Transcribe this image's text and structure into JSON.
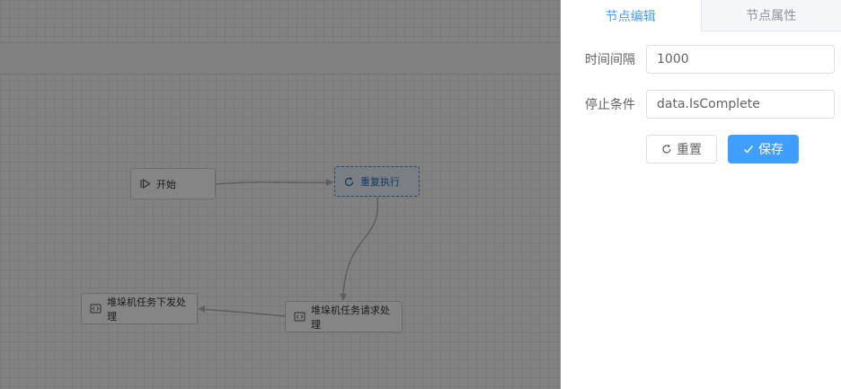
{
  "flow": {
    "nodes": [
      {
        "id": "start",
        "label": "开始",
        "icon": "play-step-icon"
      },
      {
        "id": "repeat",
        "label": "重复执行",
        "icon": "loop-icon"
      },
      {
        "id": "request",
        "label": "堆垛机任务请求处理",
        "icon": "code-icon"
      },
      {
        "id": "dispatch",
        "label": "堆垛机任务下发处理",
        "icon": "code-icon"
      }
    ]
  },
  "drawer": {
    "tabs": [
      {
        "label": "节点编辑",
        "active": true
      },
      {
        "label": "节点属性",
        "active": false
      }
    ],
    "form": {
      "interval": {
        "label": "时间间隔",
        "value": "1000"
      },
      "stop_condition": {
        "label": "停止条件",
        "value": "data.IsComplete"
      }
    },
    "buttons": {
      "reset": {
        "label": "重置",
        "icon": "refresh-icon"
      },
      "save": {
        "label": "保存",
        "icon": "check-icon"
      }
    }
  },
  "colors": {
    "accent": "#409eff",
    "overlay": "rgba(0,0,0,0.48)"
  }
}
